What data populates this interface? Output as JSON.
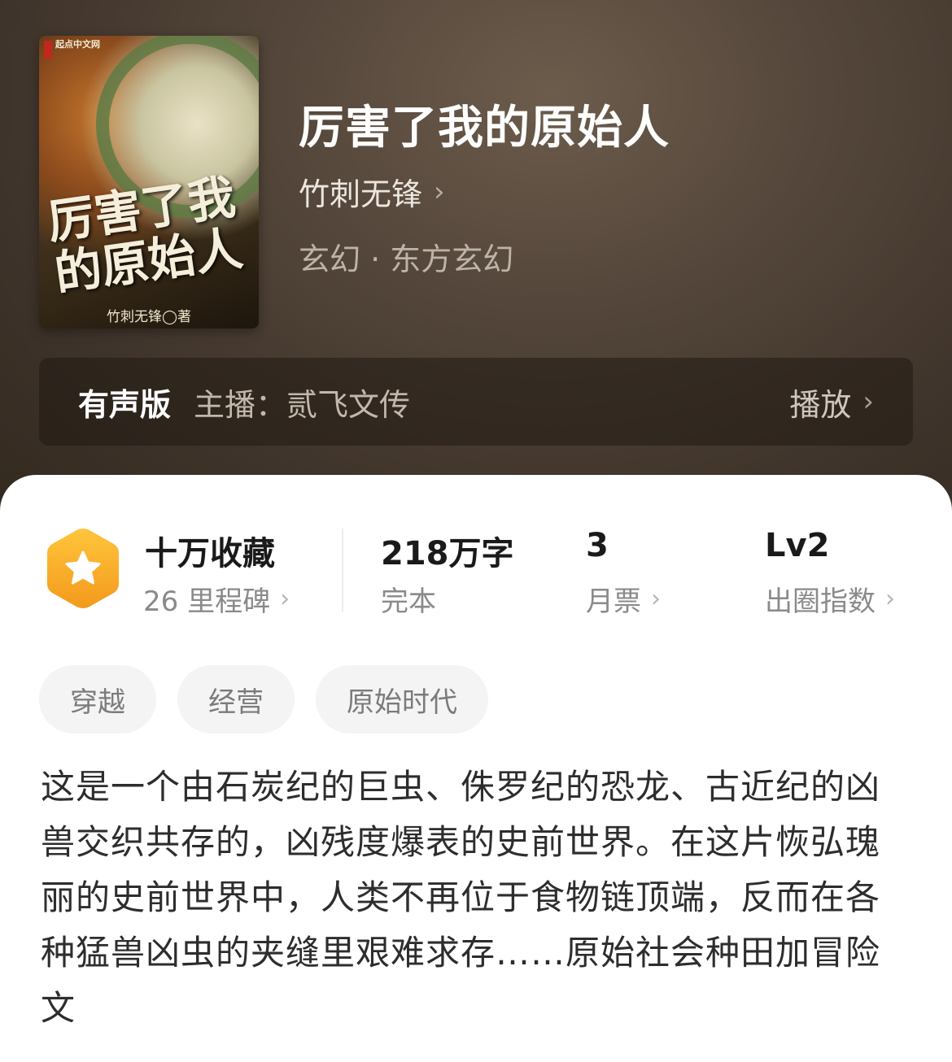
{
  "book": {
    "title": "厉害了我的原始人",
    "author": "竹刺无锋",
    "genre": "玄幻 · 东方玄幻",
    "cover": {
      "site_text": "起点中文网",
      "title_text": "厉害了我的原始人",
      "author_text": "竹刺无锋◯著"
    }
  },
  "audio": {
    "label": "有声版",
    "host": "主播：贰飞文传",
    "play": "播放"
  },
  "stats": {
    "favorites": {
      "main": "十万收藏",
      "sub": "26 里程碑"
    },
    "words": {
      "main": "218万字",
      "sub": "完本"
    },
    "tickets": {
      "main": "3",
      "sub": "月票"
    },
    "level": {
      "main": "Lv2",
      "sub": "出圈指数"
    }
  },
  "tags": [
    "穿越",
    "经营",
    "原始时代"
  ],
  "description": "这是一个由石炭纪的巨虫、侏罗纪的恐龙、古近纪的凶兽交织共存的，凶残度爆表的史前世界。在这片恢弘瑰丽的史前世界中，人类不再位于食物链顶端，反而在各种猛兽凶虫的夹缝里艰难求存……原始社会种田加冒险文",
  "colors": {
    "header_bg": "#4f4236",
    "badge_orange": "#f5a623",
    "card_bg": "#ffffff"
  },
  "icons": [
    "chevron-right-icon",
    "star-hexagon-icon"
  ]
}
